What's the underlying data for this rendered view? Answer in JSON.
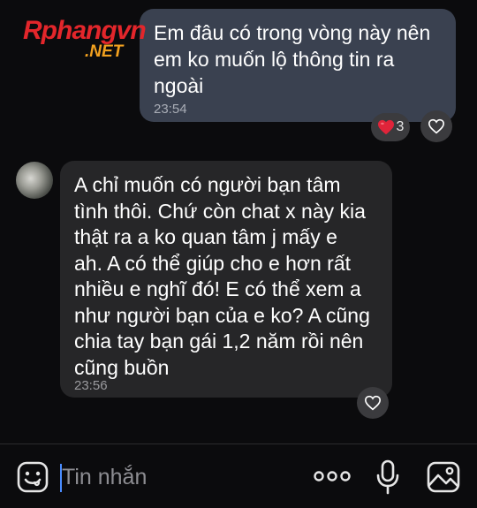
{
  "watermark": {
    "brand_main": "Rphangvn",
    "brand_sub": ".NET"
  },
  "colors": {
    "outgoing_bubble": "#3a4150",
    "incoming_bubble": "#262628",
    "background": "#0b0b0d",
    "reaction_heart": "#e0243a",
    "caret": "#4a8cff"
  },
  "messages": [
    {
      "direction": "outgoing",
      "text": "Em đâu có trong vòng này nên\nem ko muốn lộ thông tin ra\nngoài",
      "time": "23:54",
      "reaction": {
        "icon": "heart-icon",
        "count": "3"
      }
    },
    {
      "direction": "incoming",
      "text": "A chỉ muốn có người bạn tâm\ntình thôi. Chứ còn chat x này kia\nthật ra a ko quan tâm j mấy e\nah. A có thể giúp cho e hơn rất\nnhiều e nghĩ đó! E có thể xem a\nnhư người bạn của e ko? A cũng\nchia tay bạn gái 1,2 năm rồi nên\ncũng buồn",
      "time": "23:56"
    }
  ],
  "composer": {
    "placeholder": "Tin nhắn",
    "value": ""
  },
  "icons": {
    "emoji": "sticker-smile-icon",
    "more": "more-dots-icon",
    "mic": "microphone-icon",
    "image": "image-icon",
    "like": "heart-outline-icon"
  }
}
